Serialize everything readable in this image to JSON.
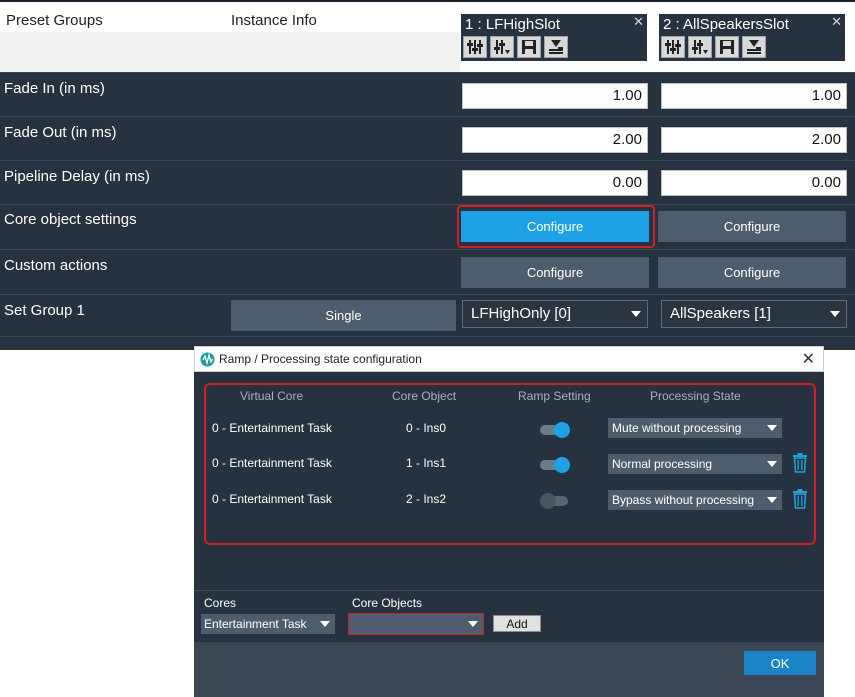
{
  "header": {
    "preset_groups": "Preset Groups",
    "instance_info": "Instance Info"
  },
  "slots": [
    {
      "title": "1 : LFHighSlot",
      "close": "✕"
    },
    {
      "title": "2 : AllSpeakersSlot",
      "close": "✕"
    }
  ],
  "rows": {
    "fade_in": {
      "label": "Fade In (in ms)",
      "values": [
        "1.00",
        "1.00"
      ]
    },
    "fade_out": {
      "label": "Fade Out (in ms)",
      "values": [
        "2.00",
        "2.00"
      ]
    },
    "pipeline_delay": {
      "label": "Pipeline Delay (in ms)",
      "values": [
        "0.00",
        "0.00"
      ]
    },
    "core_object_settings": {
      "label": "Core object settings",
      "buttons": [
        "Configure",
        "Configure"
      ]
    },
    "custom_actions": {
      "label": "Custom actions",
      "buttons": [
        "Configure",
        "Configure"
      ]
    },
    "set_group": {
      "label": "Set Group 1",
      "single": "Single",
      "selects": [
        "LFHighOnly [0]",
        "AllSpeakers [1]"
      ]
    }
  },
  "dialog": {
    "title": "Ramp / Processing state configuration",
    "close": "✕",
    "columns": [
      "Virtual Core",
      "Core Object",
      "Ramp Setting",
      "Processing State"
    ],
    "rows": [
      {
        "virtual_core": "0 - Entertainment Task",
        "core_object": "0 - Ins0",
        "ramp": true,
        "state": "Mute without processing",
        "deletable": false
      },
      {
        "virtual_core": "0 - Entertainment Task",
        "core_object": "1 - Ins1",
        "ramp": true,
        "state": "Normal processing",
        "deletable": true
      },
      {
        "virtual_core": "0 - Entertainment Task",
        "core_object": "2 - Ins2",
        "ramp": false,
        "state": "Bypass without processing",
        "deletable": true
      }
    ],
    "cores_label": "Cores",
    "cores_value": "Entertainment Task",
    "core_objects_label": "Core Objects",
    "core_objects_value": "",
    "add_label": "Add",
    "ok_label": "OK"
  },
  "colors": {
    "accent": "#1ea2e5",
    "highlight": "#d21f26",
    "panel": "#26323f"
  }
}
